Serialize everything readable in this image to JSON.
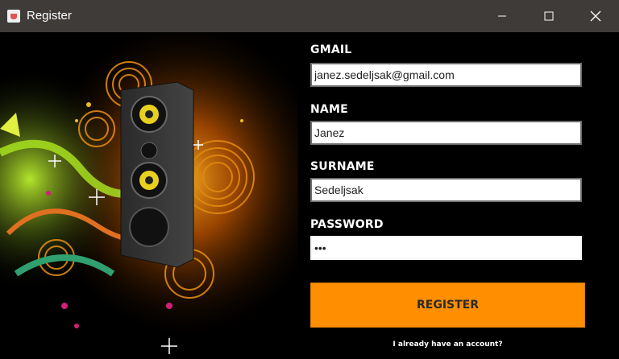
{
  "window": {
    "title": "Register",
    "app_icon": "java-cup-icon",
    "controls": [
      "minimize-icon",
      "maximize-icon",
      "close-icon"
    ]
  },
  "artwork": {
    "description_icon": "speaker-music-art-image"
  },
  "form": {
    "gmail_label": "GMAIL",
    "gmail_value": "janez.sedeljsak@gmail.com",
    "name_label": "NAME",
    "name_value": "Janez",
    "surname_label": "SURNAME",
    "surname_value": "Sedeljsak",
    "password_label": "PASSWORD",
    "password_value": "•••",
    "register_label": "REGISTER",
    "login_link": "I already have an account?"
  },
  "colors": {
    "accent": "#ff8f00",
    "background": "#000000",
    "titlebar": "#3e3b39"
  }
}
